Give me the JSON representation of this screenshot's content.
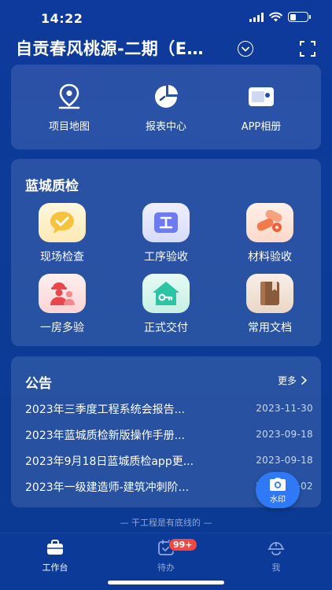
{
  "status_bar": {
    "time": "14:22",
    "battery_level": 0.35
  },
  "header": {
    "project_title": "自贡春风桃源-二期（E…",
    "dropdown_icon": "chevron-down-circle-icon",
    "scan_icon": "fullscreen-scan-icon"
  },
  "quick_links": [
    {
      "label": "项目地图",
      "icon": "map-pin-icon"
    },
    {
      "label": "报表中心",
      "icon": "pie-chart-icon"
    },
    {
      "label": "APP相册",
      "icon": "album-icon"
    }
  ],
  "quality_section": {
    "title": "蓝城质检",
    "items": [
      {
        "label": "现场检查",
        "icon": "chat-check-icon",
        "color": "#f7c33c"
      },
      {
        "label": "工序验收",
        "icon": "process-icon",
        "color": "#6d7bf2"
      },
      {
        "label": "材料验收",
        "icon": "materials-icon",
        "color": "#f27a4e"
      },
      {
        "label": "一房多验",
        "icon": "inspector-icon",
        "color": "#e9474b"
      },
      {
        "label": "正式交付",
        "icon": "house-key-icon",
        "color": "#2cc5a4"
      },
      {
        "label": "常用文档",
        "icon": "book-icon",
        "color": "#8a5a3c"
      }
    ]
  },
  "announcements": {
    "title": "公告",
    "more_label": "更多",
    "items": [
      {
        "title": "2023年三季度工程系统会报告...",
        "date": "2023-11-30"
      },
      {
        "title": "2023年蓝城质检新版操作手册...",
        "date": "2023-09-18"
      },
      {
        "title": "2023年9月18日蓝城质检app更...",
        "date": "2023-09-18"
      },
      {
        "title": "2023年一级建造师-建筑冲刺阶...",
        "date": "2023-09-02"
      }
    ]
  },
  "watermark_button": {
    "label": "水印",
    "icon": "camera-icon"
  },
  "slogan": "— 干工程是有底线的 —",
  "tabbar": {
    "tabs": [
      {
        "label": "工作台",
        "icon": "briefcase-icon",
        "active": true
      },
      {
        "label": "待办",
        "icon": "todo-icon",
        "badge": "99+"
      },
      {
        "label": "我",
        "icon": "helmet-icon"
      }
    ]
  },
  "colors": {
    "background": "#0d3a9c",
    "accent": "#2f79f6",
    "badge": "#f04842"
  }
}
